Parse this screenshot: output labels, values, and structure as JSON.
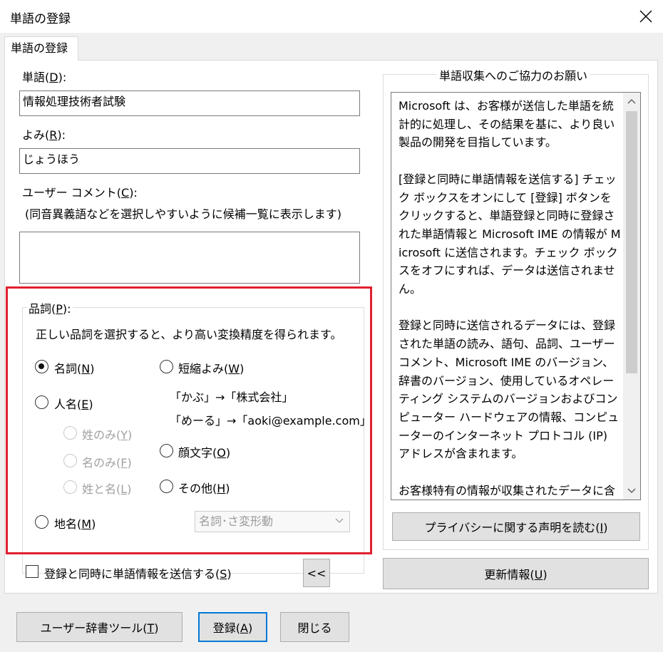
{
  "window": {
    "title": "単語の登録"
  },
  "tab": {
    "label": "単語の登録"
  },
  "word": {
    "label_pre": "単語(",
    "label_key": "D",
    "label_post": "):",
    "value": "情報処理技術者試験"
  },
  "yomi": {
    "label_pre": "よみ(",
    "label_key": "R",
    "label_post": "):",
    "value": "じょうほう"
  },
  "comment": {
    "label_pre": "ユーザー コメント(",
    "label_key": "C",
    "label_post": "):",
    "hint": "(同音異義語などを選択しやすいように候補一覧に表示します)",
    "value": ""
  },
  "pos": {
    "label_pre": "品詞(",
    "label_key": "P",
    "label_post": "):",
    "description": "正しい品詞を選択すると、より高い変換精度を得られます。",
    "meishi": {
      "pre": "名詞(",
      "key": "N",
      "post": ")",
      "checked": true
    },
    "jinmei": {
      "pre": "人名(",
      "key": "E",
      "post": ")"
    },
    "sei": {
      "pre": "姓のみ(",
      "key": "Y",
      "post": ")"
    },
    "mei": {
      "pre": "名のみ(",
      "key": "F",
      "post": ")"
    },
    "seitomei": {
      "pre": "姓と名(",
      "key": "L",
      "post": ")"
    },
    "chimei": {
      "pre": "地名(",
      "key": "M",
      "post": ")"
    },
    "tanshuku": {
      "pre": "短縮よみ(",
      "key": "W",
      "post": ")"
    },
    "example1": "「かぶ」→「株式会社」",
    "example2": "「めーる」→「aoki@example.com」",
    "kaomoji": {
      "pre": "顔文字(",
      "key": "O",
      "post": ")"
    },
    "sonota": {
      "pre": "その他(",
      "key": "H",
      "post": ")"
    },
    "combo_value": "名詞･さ変形動"
  },
  "info": {
    "group_label": "単語収集へのご協力のお願い",
    "paragraphs": [
      "Microsoft は、お客様が送信した単語を統計的に処理し、その結果を基に、より良い製品の開発を目指しています。",
      "[登録と同時に単語情報を送信する] チェック ボックスをオンにして [登録] ボタンをクリックすると、単語登録と同時に登録された単語情報と Microsoft IME の情報が Microsoft に送信されます。チェック ボックスをオフにすれば、データは送信されません。",
      "登録と同時に送信されるデータには、登録された単語の読み、語句、品詞、ユーザー コメント、Microsoft IME のバージョン、辞書のバージョン、使用しているオペレーティング システムのバージョンおよびコンピューター ハードウェアの情報、コンピューターのインターネット プロトコル (IP) アドレスが含まれます。",
      "お客様特有の情報が収集されたデータに含まれることがあります。このような情報が存在する場合でも、Microsoft では、お客様を特定するために使用することはありません。"
    ],
    "privacy_pre": "プライバシーに関する声明を読む(",
    "privacy_key": "I",
    "privacy_post": ")",
    "update_pre": "更新情報(",
    "update_key": "U",
    "update_post": ")"
  },
  "send": {
    "pre": "登録と同時に単語情報を送信する(",
    "key": "S",
    "post": ")",
    "checked": false
  },
  "collapse_label": "<<",
  "buttons": {
    "dict_pre": "ユーザー辞書ツール(",
    "dict_key": "T",
    "dict_post": ")",
    "register_pre": "登録(",
    "register_key": "A",
    "register_post": ")",
    "close": "閉じる"
  }
}
